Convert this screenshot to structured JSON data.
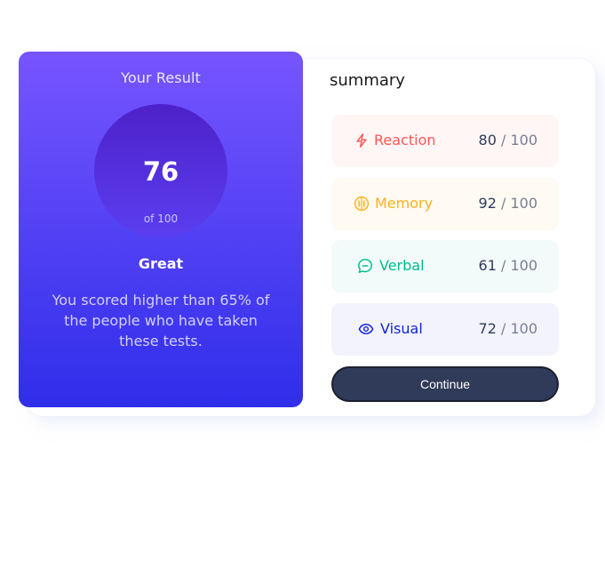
{
  "result": {
    "title": "Your Result",
    "score": "76",
    "out_of": "of 100",
    "rating": "Great",
    "description": "You scored higher than 65% of the people who have taken these tests."
  },
  "summary": {
    "title": "summary",
    "items": [
      {
        "label": "Reaction",
        "score": "80",
        "max": " / 100",
        "color": "#ff5757",
        "icon": "lightning-icon"
      },
      {
        "label": "Memory",
        "score": "92",
        "max": " / 100",
        "color": "#ffb01f",
        "icon": "brain-icon"
      },
      {
        "label": "Verbal",
        "score": "61",
        "max": " / 100",
        "color": "#00bb8f",
        "icon": "chat-bubble-icon"
      },
      {
        "label": "Visual",
        "score": "72",
        "max": " / 100",
        "color": "#1125d4",
        "icon": "eye-icon"
      }
    ],
    "continue_label": "Continue"
  },
  "colors": {
    "gradient_top": "#7755ff",
    "gradient_bottom": "#2f2eea",
    "button": "#303b5a"
  }
}
